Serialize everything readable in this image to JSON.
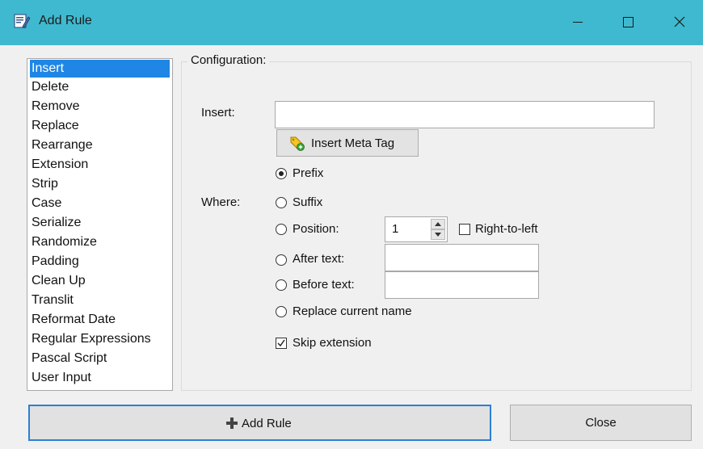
{
  "window": {
    "title": "Add Rule",
    "icon": "rename-icon",
    "controls": [
      "minimize-icon",
      "maximize-icon",
      "close-icon"
    ]
  },
  "rules": {
    "selected": "Insert",
    "items": [
      "Insert",
      "Delete",
      "Remove",
      "Replace",
      "Rearrange",
      "Extension",
      "Strip",
      "Case",
      "Serialize",
      "Randomize",
      "Padding",
      "Clean Up",
      "Translit",
      "Reformat Date",
      "Regular Expressions",
      "Pascal Script",
      "User Input"
    ]
  },
  "config": {
    "legend": "Configuration:",
    "insert_label": "Insert:",
    "insert_value": "",
    "meta_button": "Insert Meta Tag",
    "where_label": "Where:",
    "options": {
      "prefix": "Prefix",
      "suffix": "Suffix",
      "position": "Position:",
      "after_text": "After text:",
      "before_text": "Before text:",
      "replace": "Replace current name"
    },
    "selected_option": "Prefix",
    "position_value": "1",
    "right_to_left": {
      "label": "Right-to-left",
      "checked": false
    },
    "after_text_value": "",
    "before_text_value": "",
    "skip_extension": {
      "label": "Skip extension",
      "checked": true
    }
  },
  "buttons": {
    "add_rule": "Add Rule",
    "close": "Close"
  },
  "colors": {
    "titlebar": "#3fb9cf",
    "selection": "#1f86e6",
    "focus_border": "#2c7fd6"
  }
}
